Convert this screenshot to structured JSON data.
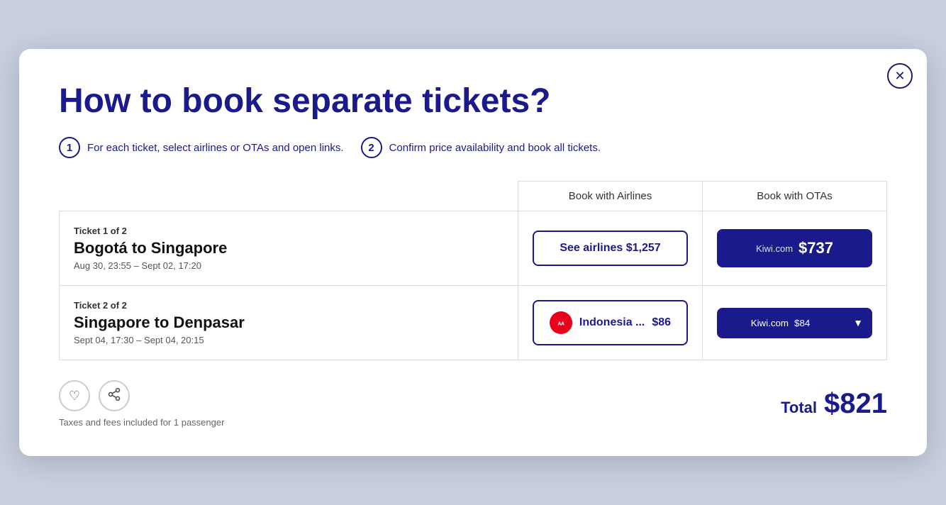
{
  "modal": {
    "title": "How to book separate tickets?",
    "close_label": "×",
    "step1_num": "1",
    "step1_text": "For each ticket, select airlines or OTAs and open links.",
    "step2_num": "2",
    "step2_text": "Confirm price availability and book all tickets.",
    "col_airlines": "Book with Airlines",
    "col_otas": "Book with OTAs",
    "tickets": [
      {
        "label": "Ticket 1 of 2",
        "route": "Bogotá to Singapore",
        "dates": "Aug 30, 23:55 – Sept 02, 17:20",
        "airlines_btn": "See airlines  $1,257",
        "ota_name": "Kiwi.com",
        "ota_price": "$737"
      },
      {
        "label": "Ticket 2 of 2",
        "route": "Singapore to Denpasar",
        "dates": "Sept 04, 17:30 – Sept 04, 20:15",
        "airlines_name": "Indonesia ...",
        "airlines_price": "$86",
        "airlines_logo": "AirAsia",
        "ota_name": "Kiwi.com",
        "ota_price": "$84"
      }
    ],
    "footer": {
      "taxes_note": "Taxes and fees included for 1 passenger",
      "total_label": "Total",
      "total_price": "$821"
    }
  }
}
